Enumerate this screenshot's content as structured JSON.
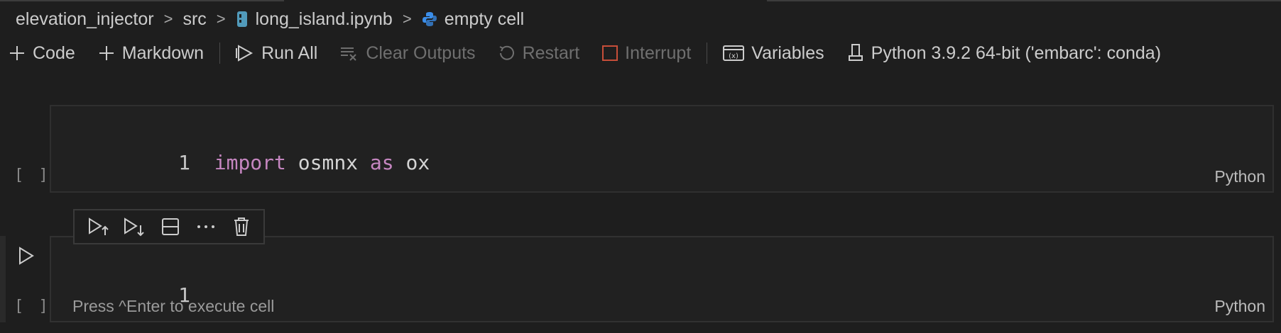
{
  "breadcrumb": {
    "items": [
      "elevation_injector",
      "src",
      "long_island.ipynb",
      "empty cell"
    ]
  },
  "toolbar": {
    "code_label": "Code",
    "markdown_label": "Markdown",
    "run_all_label": "Run All",
    "clear_outputs_label": "Clear Outputs",
    "restart_label": "Restart",
    "interrupt_label": "Interrupt",
    "variables_label": "Variables",
    "kernel_label": "Python 3.9.2 64-bit ('embarc': conda)"
  },
  "cells": [
    {
      "line_number": "1",
      "code_keyword1": "import",
      "code_module": "osmnx",
      "code_keyword2": "as",
      "code_alias": "ox",
      "exec_count": "[ ]",
      "language": "Python"
    },
    {
      "line_number": "1",
      "exec_count": "[ ]",
      "status": "Press ^Enter to execute cell",
      "language": "Python"
    }
  ],
  "colors": {
    "background": "#1e1e1e",
    "keyword": "#c586c0",
    "notebook_icon": "#519aba",
    "python_icon": "#3b8eea",
    "interrupt_icon": "#c74e39"
  },
  "icons": [
    "plus-icon",
    "run-all-icon",
    "clear-outputs-icon",
    "restart-icon",
    "interrupt-icon",
    "variables-icon",
    "kernel-icon",
    "run-above-icon",
    "run-below-icon",
    "split-cell-icon",
    "more-icon",
    "delete-icon",
    "run-cell-icon",
    "notebook-file-icon",
    "python-icon"
  ]
}
